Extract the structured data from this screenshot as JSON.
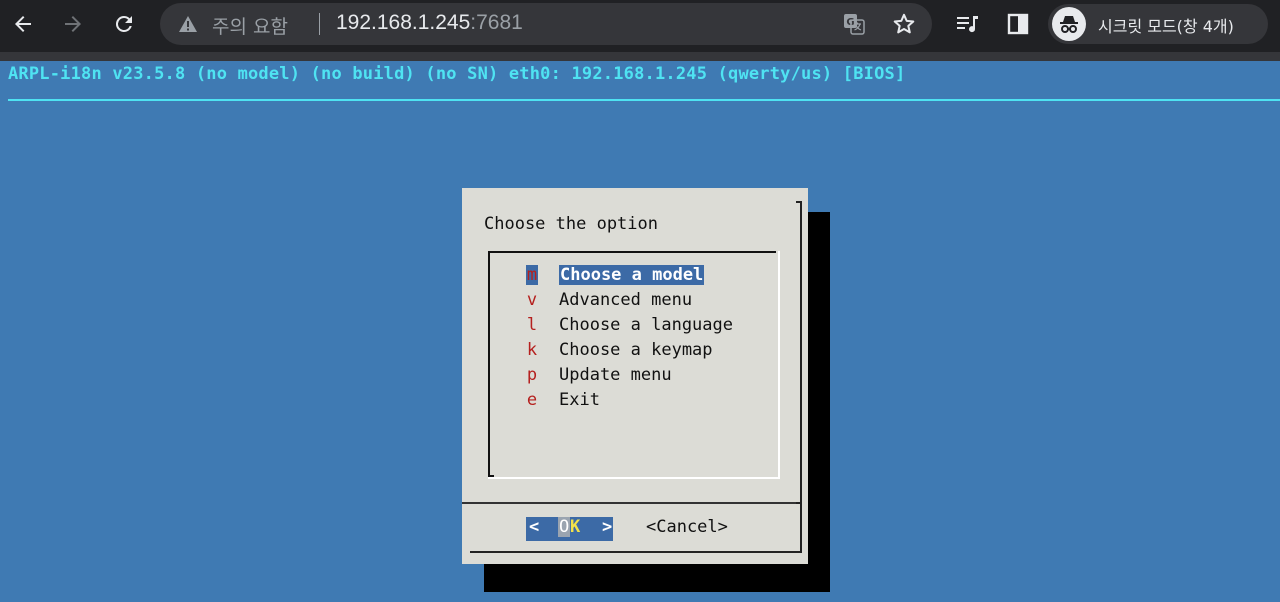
{
  "browser": {
    "security_label": "주의 요함",
    "url_host": "192.168.1.245",
    "url_port": ":7681",
    "profile_label": "시크릿 모드(창 4개)",
    "icons": [
      "back-icon",
      "forward-icon",
      "reload-icon",
      "warning-icon",
      "translate-icon",
      "star-icon",
      "reading-list-icon",
      "side-panel-icon",
      "incognito-icon"
    ]
  },
  "terminal": {
    "title": "ARPL-i18n v23.5.8 (no model) (no build) (no SN) eth0: 192.168.1.245 (qwerty/us) [BIOS]",
    "background": "#3f7ab3",
    "accent": "#4fe3f2"
  },
  "dialog": {
    "prompt": "Choose the option",
    "items": [
      {
        "key": "m",
        "label": "Choose a model",
        "selected": true
      },
      {
        "key": "v",
        "label": "Advanced menu"
      },
      {
        "key": "l",
        "label": "Choose a language"
      },
      {
        "key": "k",
        "label": "Choose a keymap"
      },
      {
        "key": "p",
        "label": "Update menu"
      },
      {
        "key": "e",
        "label": "Exit"
      }
    ],
    "ok": {
      "left": "<",
      "o": "O",
      "k": "K",
      "right": ">"
    },
    "cancel": "<Cancel>"
  }
}
